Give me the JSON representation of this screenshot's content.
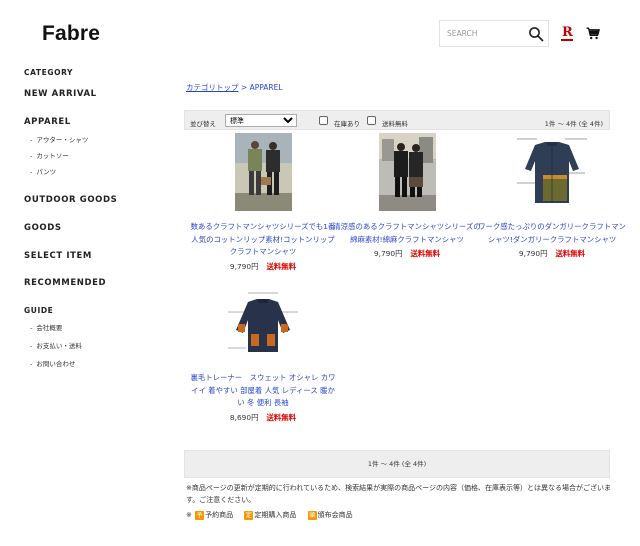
{
  "header": {
    "logo": "Fabre",
    "search_placeholder": "SEARCH",
    "rakuten": "R"
  },
  "sidebar": {
    "category_heading": "CATEGORY",
    "new_arrival": "NEW ARRIVAL",
    "apparel": "APPAREL",
    "apparel_sub": [
      "アウター・シャツ",
      "カットソー",
      "パンツ"
    ],
    "outdoor_goods": "OUTDOOR GOODS",
    "goods": "GOODS",
    "select_item": "SELECT ITEM",
    "recommended": "RECOMMENDED",
    "guide_heading": "GUIDE",
    "guide_sub": [
      "会社概要",
      "お支払い・送料",
      "お問い合わせ"
    ]
  },
  "breadcrumb": {
    "parent": "カテゴリトップ",
    "separator": ">",
    "current": "APPAREL"
  },
  "toolbar": {
    "sort_label": "並び替え",
    "sort_selected": "標準",
    "in_stock": "在庫あり",
    "free_shipping": "送料無料",
    "count": "1件 〜 4件 (全 4件)"
  },
  "products": [
    {
      "title": "数あるクラフトマンシャツシリーズでも1番人気のコットンリップ素材!コットンリップクラフトマンシャツ",
      "price": "9,790円",
      "shipping": "送料無料"
    },
    {
      "title": "清涼感のあるクラフトマンシャツシリーズの綿麻素材!綿麻クラフトマンシャツ",
      "price": "9,790円",
      "shipping": "送料無料"
    },
    {
      "title": "ワーク感たっぷりのダンガリークラフトマンシャツ!ダンガリークラフトマンシャツ",
      "price": "9,790円",
      "shipping": "送料無料"
    },
    {
      "title": "裏毛トレーナー　スウェット オシャレ カワイイ 着やすい 部屋着 人気 レディース 暖かい 冬 便利 長袖",
      "price": "8,690円",
      "shipping": "送料無料"
    }
  ],
  "footer_bar": {
    "count": "1件 〜 4件 (全 4件)"
  },
  "notice": "※商品ページの更新が定期的に行われているため、検索結果が実際の商品ページの内容（価格、在庫表示等）とは異なる場合がございます。ご注意ください。",
  "legend": {
    "prefix": "※",
    "items": [
      {
        "badge": "予",
        "label": "予約商品",
        "color": "#f39800"
      },
      {
        "badge": "定",
        "label": "定期購入商品",
        "color": "#f39800"
      },
      {
        "badge": "頒",
        "label": "頒布会商品",
        "color": "#f39800"
      }
    ]
  },
  "colors": {
    "link": "#2a46d1",
    "shipping_red": "#dd0000",
    "rakuten_red": "#bf0000"
  }
}
